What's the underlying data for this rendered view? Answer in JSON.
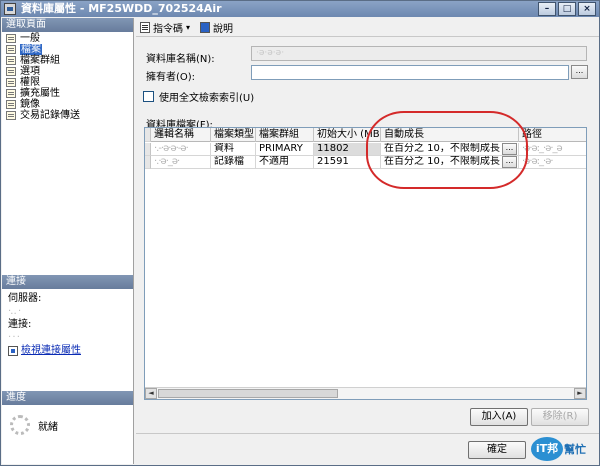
{
  "window": {
    "title": "資料庫屬性 - MF25WDD_702524Air",
    "controls": {
      "minimize": "–",
      "maximize": "□",
      "close": "×"
    }
  },
  "left_pane": {
    "select_page_header": "選取頁面",
    "pages": [
      {
        "label": "一般",
        "icon": "page-icon",
        "selected": false
      },
      {
        "label": "檔案",
        "icon": "page-icon",
        "selected": true
      },
      {
        "label": "檔案群組",
        "icon": "page-icon",
        "selected": false
      },
      {
        "label": "選項",
        "icon": "page-icon",
        "selected": false
      },
      {
        "label": "權限",
        "icon": "page-icon",
        "selected": false
      },
      {
        "label": "擴充屬性",
        "icon": "page-icon",
        "selected": false
      },
      {
        "label": "鏡像",
        "icon": "page-icon",
        "selected": false
      },
      {
        "label": "交易記錄傳送",
        "icon": "page-icon",
        "selected": false
      }
    ],
    "connection_header": "連接",
    "server_label": "伺服器:",
    "server_value": "·‥ ·",
    "connection_label": "連接:",
    "connection_value": "· · ·",
    "view_connection_link": "檢視連接屬性",
    "progress_header": "進度",
    "progress_status": "就緒"
  },
  "toolbar": {
    "script_label": "指令碼",
    "script_caret": "▾",
    "help_label": "說明"
  },
  "form": {
    "db_name_label": "資料庫名稱(N):",
    "db_name_value": "·ǝ·ǝ·ǝ·",
    "owner_label": "擁有者(O):",
    "owner_value": "",
    "owner_browse": "...",
    "fulltext_label": "使用全文檢索索引(U)",
    "fulltext_checked": false,
    "files_label": "資料庫檔案(F):"
  },
  "grid": {
    "columns": [
      "邏輯名稱",
      "檔案類型",
      "檔案群組",
      "初始大小 (MB)",
      "自動成長",
      "路徑"
    ],
    "rows": [
      {
        "logical_name": "·.-·ǝ·ǝ·-ǝ·",
        "file_type": "資料",
        "filegroup": "PRIMARY",
        "initial_size": "11802",
        "autogrowth": "在百分之 10，不限制成長",
        "autogrowth_btn": "...",
        "path": "·ǝ·ǝ:_·ǝ·_ǝ"
      },
      {
        "logical_name": "·.·ǝ·_ǝ·",
        "file_type": "記錄檔",
        "filegroup": "不適用",
        "initial_size": "21591",
        "autogrowth": "在百分之 10，不限制成長",
        "autogrowth_btn": "...",
        "path": "·ǝ·ǝ:_·ǝ·"
      }
    ],
    "scroll_left": "◄",
    "scroll_right": "►"
  },
  "buttons": {
    "add": "加入(A)",
    "remove": "移除(R)",
    "ok": "確定"
  },
  "watermark": {
    "badge": "iT邦",
    "text": "幫忙"
  },
  "colors": {
    "title_bar": "#7c95ba",
    "section_header": "#7489a8",
    "selection": "#3169c6",
    "annotation": "#d42a2a"
  }
}
